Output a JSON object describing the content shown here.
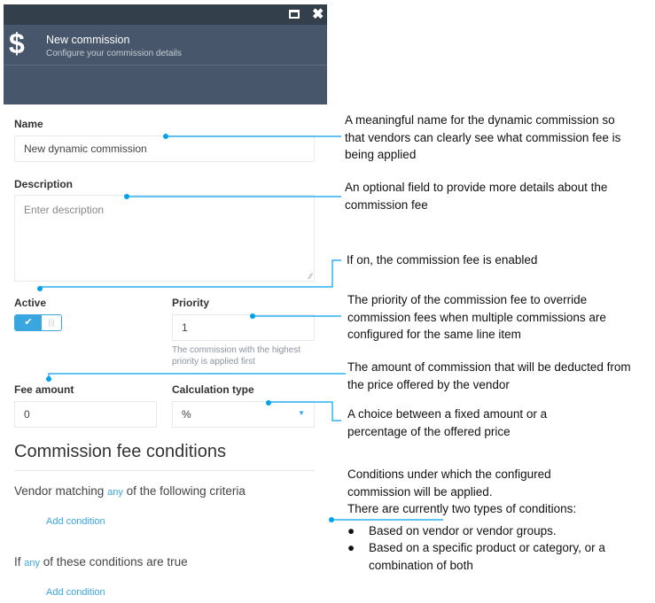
{
  "dialog": {
    "icons": {
      "maximize": "maximize-icon",
      "close": "close-icon",
      "header": "dollar-icon"
    },
    "title": "New commission",
    "subtitle": "Configure your commission details",
    "name": {
      "label": "Name",
      "value": "New dynamic commission"
    },
    "description": {
      "label": "Description",
      "placeholder": "Enter description"
    },
    "active": {
      "label": "Active",
      "on": true
    },
    "priority": {
      "label": "Priority",
      "value": "1",
      "hint": "The commission with the highest priority is applied first"
    },
    "fee_amount": {
      "label": "Fee amount",
      "value": "0"
    },
    "calculation_type": {
      "label": "Calculation type",
      "value": "%"
    },
    "conditions": {
      "title": "Commission fee conditions",
      "vendor_prefix": "Vendor matching",
      "vendor_any": "any",
      "vendor_suffix": "of the following criteria",
      "add_condition_1": "Add condition",
      "if_prefix": "If",
      "if_any": "any",
      "if_suffix": "of these conditions are true",
      "add_condition_2": "Add condition"
    }
  },
  "annotations": {
    "name": "A meaningful name for the dynamic commission so that vendors can clearly see what commission fee is being applied",
    "description": "An optional field to provide more details about the commission fee",
    "active": "If on, the commission fee is enabled",
    "priority": "The priority of the commission fee to override commission fees when multiple commissions are configured for the same line item",
    "fee_amount": "The amount of commission that will be deducted from the price offered by the vendor",
    "calculation_type": "A choice between a fixed amount or a percentage of the offered price",
    "conditions_line1": "Conditions under which the configured commission will be applied.",
    "conditions_line2": "There are currently two types of conditions:",
    "conditions_bullets": [
      "Based on vendor or vendor groups.",
      "Based on a specific product or category, or a combination of both"
    ]
  },
  "colors": {
    "accent": "#00a2e8",
    "header": "#47566a",
    "titlebar": "#343f4c",
    "link": "#3aa6e0"
  }
}
